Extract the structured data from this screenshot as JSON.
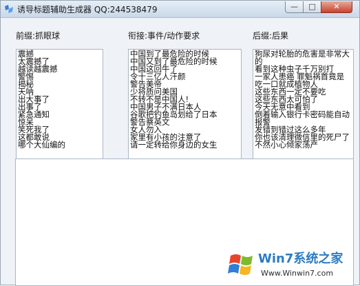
{
  "window": {
    "title": "诱导标题辅助生成器 QQ:244538479",
    "buttons": {
      "minimize": "—",
      "maximize": "□",
      "close": "✕"
    }
  },
  "columns": [
    {
      "label": "前缀:抓眼球",
      "lines": [
        "震撼",
        "太震撼了",
        "越读越震撼",
        "警惕",
        "揭秘",
        "天呐",
        "出大事了",
        "出事了",
        "紧急通知",
        "惊呆",
        "笑死我了",
        "这都敢说",
        "哪个大仙编的"
      ]
    },
    {
      "label": "衔接:事件/动作要求",
      "lines": [
        "中国到了最危险的时候",
        "中国又到了最危险的时候",
        "中国这回牛了",
        "令十三亿人汗颜",
        "警告美帝",
        "少将质问美国",
        "不转不是中国人!",
        "中国男子不满日本人",
        "谷歌把钓鱼岛划给了日本",
        "警告蔡英文",
        "女人勿入",
        "家里有小孩的注意了",
        "请一定转给你身边的女生"
      ]
    },
    {
      "label": "后缀:后果",
      "lines": [
        "狗尿对轮胎的危害是非常大的",
        "看到这种虫子千万别打",
        "一家人患癌 罪魁祸首竟是",
        "吃一口就成植物人",
        "这些东西一定不要吃",
        "这些东西太可怕了",
        "今天无意中看到",
        "倒着输入银行卡密码能自动报警",
        "发错到错过这么多年",
        "你也该清理微信里的死尸了",
        "不然小心倾家荡产"
      ]
    }
  ],
  "output": {
    "value": ""
  },
  "watermark": {
    "brand": "Win7系统之家",
    "url": "Www.Winwin7.com"
  }
}
